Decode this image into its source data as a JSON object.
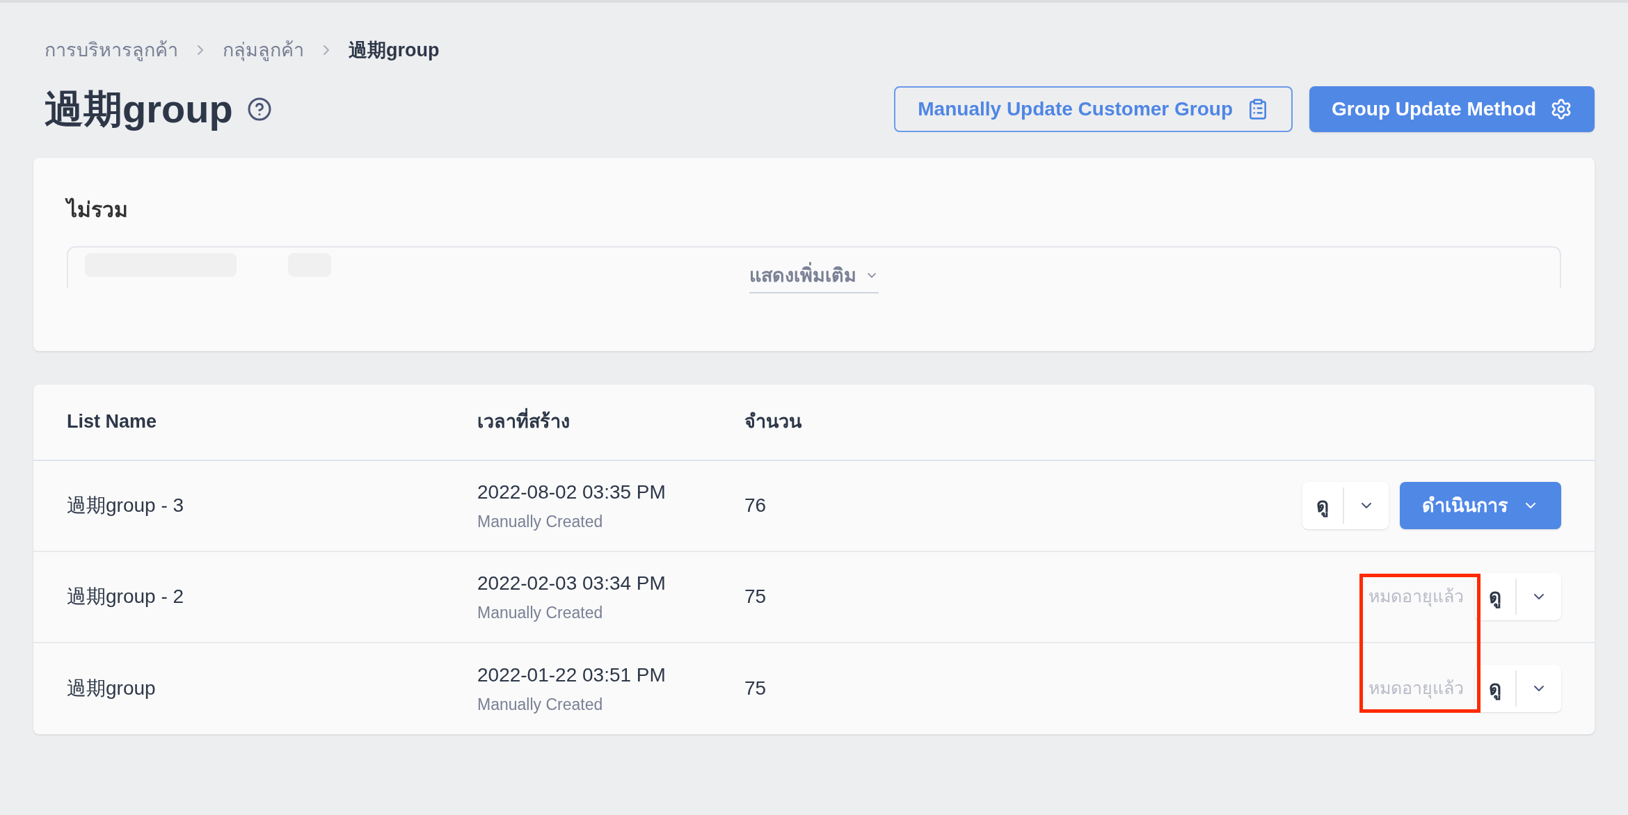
{
  "breadcrumb": [
    {
      "label": "การบริหารลูกค้า",
      "current": false
    },
    {
      "label": "กลุ่มลูกค้า",
      "current": false
    },
    {
      "label": "過期group",
      "current": true
    }
  ],
  "page_title": "過期group",
  "header_buttons": [
    {
      "label": "Manually Update Customer Group",
      "kind": "outline"
    },
    {
      "label": "Group Update Method",
      "kind": "primary"
    }
  ],
  "filter": {
    "title": "ไม่รวม",
    "show_more": "แสดงเพิ่มเติม"
  },
  "table": {
    "columns": [
      "List Name",
      "เวลาที่สร้าง",
      "จำนวน"
    ],
    "rows": [
      {
        "name": "過期group - 3",
        "created": "2022-08-02 03:35 PM",
        "created_by": "Manually Created",
        "count": "76",
        "status": null,
        "view": "ดู",
        "action": "ดำเนินการ"
      },
      {
        "name": "過期group - 2",
        "created": "2022-02-03 03:34 PM",
        "created_by": "Manually Created",
        "count": "75",
        "status": "หมดอายุแล้ว",
        "view": "ดู",
        "action": null
      },
      {
        "name": "過期group",
        "created": "2022-01-22 03:51 PM",
        "created_by": "Manually Created",
        "count": "75",
        "status": "หมดอายุแล้ว",
        "view": "ดู",
        "action": null
      }
    ]
  },
  "annotation": {
    "kind": "highlight_box",
    "color": "#ff2a00"
  }
}
